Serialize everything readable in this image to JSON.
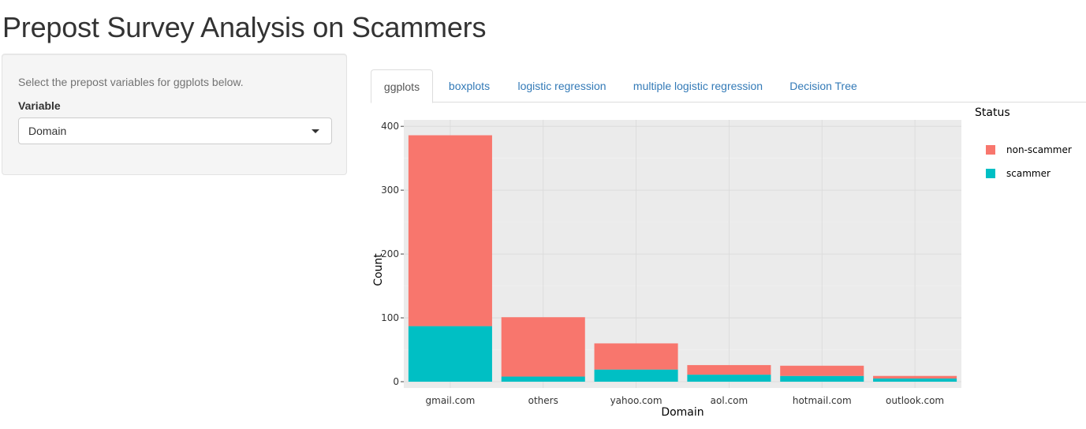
{
  "page": {
    "title": "Prepost Survey Analysis on Scammers"
  },
  "sidebar": {
    "help_text": "Select the prepost variables for ggplots below.",
    "variable_label": "Variable",
    "selected_value": "Domain"
  },
  "tabs": [
    {
      "label": "ggplots",
      "active": true
    },
    {
      "label": "boxplots",
      "active": false
    },
    {
      "label": "logistic regression",
      "active": false
    },
    {
      "label": "multiple logistic regression",
      "active": false
    },
    {
      "label": "Decision Tree",
      "active": false
    }
  ],
  "colors": {
    "non_scammer": "#F8766D",
    "scammer": "#00BFC4",
    "panel_bg": "#EBEBEB",
    "grid": "#D9D9D9",
    "tab_link": "#337ab7"
  },
  "chart_data": {
    "type": "bar",
    "stacked": true,
    "categories": [
      "gmail.com",
      "others",
      "yahoo.com",
      "aol.com",
      "hotmail.com",
      "outlook.com"
    ],
    "series": [
      {
        "name": "scammer",
        "values": [
          87,
          8,
          19,
          11,
          9,
          5
        ]
      },
      {
        "name": "non-scammer",
        "values": [
          299,
          93,
          41,
          15,
          16,
          4
        ]
      }
    ],
    "xlabel": "Domain",
    "ylabel": "Count",
    "ylim": [
      0,
      420
    ],
    "yticks": [
      0,
      100,
      200,
      300,
      400
    ],
    "legend_title": "Status",
    "legend_entries": [
      "non-scammer",
      "scammer"
    ],
    "legend_position": "right",
    "grid": true
  }
}
